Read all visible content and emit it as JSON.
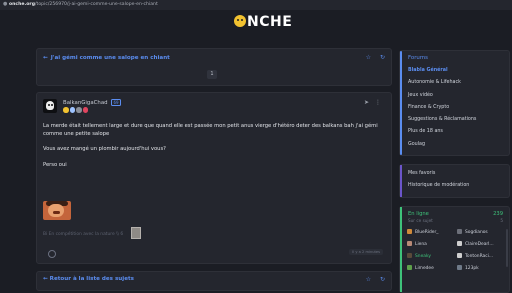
{
  "browser": {
    "url_host": "onche.org",
    "url_path": "/topic/256970/j-ai-gemi-comme-une-salope-en-chiant"
  },
  "header": {
    "logo_text": "NCHE"
  },
  "topic": {
    "title": "J'ai gémi comme une salope en chiant",
    "page_number": "1"
  },
  "post": {
    "author": "BalkanGigaChad",
    "author_badge": "69",
    "badge_colors": [
      "#f2c230",
      "#9ec3ff",
      "#8a8f99",
      "#e0455f"
    ],
    "paragraphs": [
      "La merde était tellement large et dure que quand elle est passée mon petit anus vierge d'hétéro deter des balkans bah j'ai gémi comme une petite salope",
      "Vous avez mangé un plombir aujourd'hui vous?",
      "Perso oui"
    ],
    "signature": "Bi En compétition avec la nature \\\\ 6",
    "date": "Il y a 2 minutes"
  },
  "footer_nav": {
    "back_label": "Retour à la liste des sujets"
  },
  "sidebar": {
    "forum_title": "Forums",
    "forums": [
      "Blabla Général",
      "Autonomie & Lifehack",
      "Jeux vidéo",
      "Finance & Crypto",
      "Suggestions & Réclamations",
      "Plus de 18 ans",
      "Goulag"
    ],
    "links": [
      "Mes favoris",
      "Historique de modération"
    ],
    "online": {
      "title": "En ligne",
      "count": "239",
      "sub_label": "Sur ce sujet",
      "sub_count": "5",
      "users": [
        {
          "name": "BlueRider_",
          "color": "#d08a3a",
          "green": false
        },
        {
          "name": "Sogdianos",
          "color": "#6c6f79",
          "green": false
        },
        {
          "name": "Liena",
          "color": "#b98a77",
          "green": false
        },
        {
          "name": "ClaireDearl...",
          "color": "#cfcfcf",
          "green": false
        },
        {
          "name": "Sneaky",
          "color": "#5a4a3a",
          "green": true
        },
        {
          "name": "TontonRaci...",
          "color": "#cfcfcf",
          "green": false
        },
        {
          "name": "Limedee",
          "color": "#5ea04a",
          "green": false
        },
        {
          "name": "123pk",
          "color": "#6f7a88",
          "green": false
        }
      ]
    }
  },
  "colors": {
    "accent": "#5b8df0",
    "online": "#3ec27a",
    "background": "#1b1d24",
    "card": "#24262e"
  }
}
